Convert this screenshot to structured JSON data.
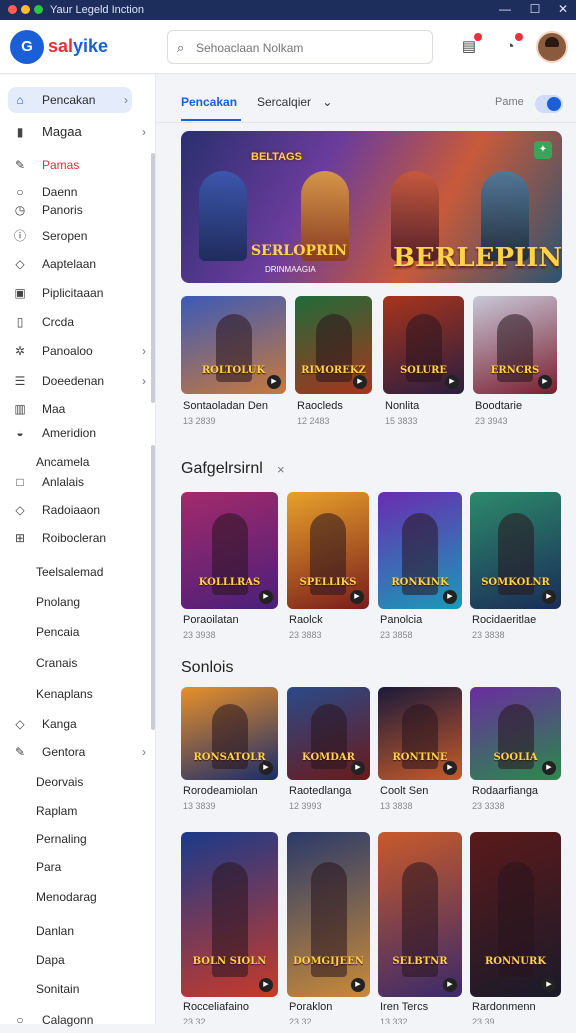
{
  "window": {
    "title": "Yaur Legeld Inction",
    "colors": {
      "close": "#ff5f57",
      "minimize": "#febc2e",
      "maximize": "#28c840"
    }
  },
  "header": {
    "logo_text": "G",
    "brand_prefix": "sal",
    "brand_suffix": "yike",
    "search_placeholder": "Sehoaclaan Nolkam",
    "notification_icons": [
      "clipboard-icon",
      "bell-icon"
    ]
  },
  "sidebar": {
    "items": [
      {
        "label": "Pencakan",
        "icon": "home-icon",
        "chevron": "›"
      },
      {
        "label": "Magaa",
        "icon": "bookmark-icon",
        "chevron": "›"
      },
      {
        "label": "Pamas",
        "icon": "pencil-icon",
        "chevron": ""
      },
      {
        "label": "Daenn",
        "icon": "circle-icon",
        "chevron": ""
      },
      {
        "label": "Panoris",
        "icon": "clock-icon",
        "chevron": ""
      },
      {
        "label": "Seropen",
        "icon": "info-icon",
        "chevron": ""
      },
      {
        "label": "Aaptelaan",
        "icon": "tag-icon",
        "chevron": ""
      },
      {
        "label": "Piplicitaaan",
        "icon": "box-icon",
        "chevron": ""
      },
      {
        "label": "Crcda",
        "icon": "book-icon",
        "chevron": ""
      },
      {
        "label": "Panoaloo",
        "icon": "gear-icon",
        "chevron": "›"
      },
      {
        "label": "Doeedenan",
        "icon": "list-icon",
        "chevron": "›"
      },
      {
        "label": "Maa",
        "icon": "library-icon",
        "chevron": ""
      },
      {
        "label": "Ameridion",
        "icon": "controller-icon",
        "chevron": ""
      },
      {
        "label": "Ancamela",
        "icon": "",
        "chevron": ""
      },
      {
        "label": "Anlalais",
        "icon": "square-icon",
        "chevron": ""
      },
      {
        "label": "Radoiaaon",
        "icon": "tag-icon",
        "chevron": ""
      },
      {
        "label": "Roibocleran",
        "icon": "plus-box-icon",
        "chevron": ""
      },
      {
        "label": "Teelsalemad",
        "icon": "",
        "chevron": ""
      },
      {
        "label": "Pnolang",
        "icon": "",
        "chevron": ""
      },
      {
        "label": "Pencaia",
        "icon": "",
        "chevron": ""
      },
      {
        "label": "Cranais",
        "icon": "",
        "chevron": ""
      },
      {
        "label": "Kenaplans",
        "icon": "",
        "chevron": ""
      },
      {
        "label": "Kanga",
        "icon": "tag-icon",
        "chevron": ""
      },
      {
        "label": "Gentora",
        "icon": "pencil-icon",
        "chevron": "›"
      },
      {
        "label": "Deorvais",
        "icon": "",
        "chevron": ""
      },
      {
        "label": "Raplam",
        "icon": "",
        "chevron": ""
      },
      {
        "label": "Pernaling",
        "icon": "",
        "chevron": ""
      },
      {
        "label": "Para",
        "icon": "",
        "chevron": ""
      },
      {
        "label": "Menodarag",
        "icon": "",
        "chevron": ""
      },
      {
        "label": "Danlan",
        "icon": "",
        "chevron": ""
      },
      {
        "label": "Dapa",
        "icon": "",
        "chevron": ""
      },
      {
        "label": "Sonitain",
        "icon": "",
        "chevron": ""
      },
      {
        "label": "Calagonn",
        "icon": "circle-icon",
        "chevron": ""
      }
    ]
  },
  "tabs": {
    "active": "Pencakan",
    "second": "Sercalqier",
    "second_caret": "⌄",
    "right_label": "Pame"
  },
  "banner": {
    "tag": "BELTAGS",
    "title": "BERLEPIIN",
    "subtitle": "SERLOPRIN",
    "subtitle_small": "DRINMAAGIA",
    "badge_icon": "leaf-icon"
  },
  "section1": {
    "title": "",
    "cards": [
      {
        "name": "Sontaoladan Den",
        "meta": "13 2839",
        "art_text": "ROLTOLUK",
        "colors": [
          "#3b5ab8",
          "#c8793b"
        ]
      },
      {
        "name": "Raocleds",
        "meta": "12 2483",
        "art_text": "RIMOREKZ",
        "colors": [
          "#1f6b3a",
          "#a8341c"
        ]
      },
      {
        "name": "Nonlita",
        "meta": "15 3833",
        "art_text": "SOLURE",
        "colors": [
          "#a8341c",
          "#2a1e40"
        ]
      },
      {
        "name": "Boodtarie",
        "meta": "23 3943",
        "art_text": "ERNCRS",
        "colors": [
          "#c8c8d8",
          "#7a1e30"
        ]
      }
    ]
  },
  "section2": {
    "title": "Gafgelrsirnl",
    "close": "×",
    "cards": [
      {
        "name": "Poraoilatan",
        "meta": "23 3938",
        "art_text": "KOLLLRAS",
        "colors": [
          "#a32a6a",
          "#4a1f7a"
        ]
      },
      {
        "name": "Raolck",
        "meta": "23 3883",
        "art_text": "SPELLIKS",
        "colors": [
          "#e8a22a",
          "#7a1c1c"
        ]
      },
      {
        "name": "Panolcia",
        "meta": "23 3858",
        "art_text": "RONKINK",
        "colors": [
          "#6a2cb0",
          "#1a9ab8"
        ]
      },
      {
        "name": "Rocidaeritlae",
        "meta": "23 3838",
        "art_text": "SOMKOLNR",
        "colors": [
          "#2c8a6a",
          "#1a2c58"
        ]
      }
    ]
  },
  "section3": {
    "title": "Sonlois",
    "cards": [
      {
        "name": "Rorodeamiolan",
        "meta": "13 3839",
        "art_text": "RONSATOLR",
        "colors": [
          "#e8902a",
          "#1a2c6a"
        ]
      },
      {
        "name": "Raotedlanga",
        "meta": "12 3993",
        "art_text": "KOMDAR",
        "colors": [
          "#2a4a8a",
          "#6a1a1a"
        ]
      },
      {
        "name": "Coolt Sen",
        "meta": "13 3838",
        "art_text": "RONTINE",
        "colors": [
          "#1a1a3a",
          "#c85a2a"
        ]
      },
      {
        "name": "Rodaarfianga",
        "meta": "23 3338",
        "art_text": "SOOLIA",
        "colors": [
          "#6a2ca0",
          "#2a8a4a"
        ]
      }
    ]
  },
  "section4": {
    "cards": [
      {
        "name": "Rocceliafaino",
        "meta": "23 32",
        "art_text": "BOLN SIOLN",
        "colors": [
          "#1a3a8a",
          "#c83a2a"
        ]
      },
      {
        "name": "Poraklon",
        "meta": "23 32",
        "art_text": "DOMGIJEEN",
        "colors": [
          "#2a3a6a",
          "#c88a3a"
        ]
      },
      {
        "name": "Iren Tercs",
        "meta": "13 332",
        "art_text": "SELBTNR",
        "colors": [
          "#c85a2a",
          "#3a2a6a"
        ]
      },
      {
        "name": "Rardonmenn",
        "meta": "23 39",
        "art_text": "RONNURK",
        "colors": [
          "#5a1a1a",
          "#1a1a2a"
        ]
      }
    ]
  }
}
